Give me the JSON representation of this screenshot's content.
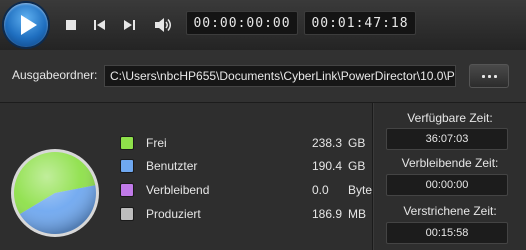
{
  "player": {
    "current_time": "00:00:00:00",
    "total_time": "00:01:47:18",
    "icons": [
      "play-icon",
      "stop-icon",
      "previous-frame-icon",
      "next-frame-icon",
      "volume-icon"
    ]
  },
  "output": {
    "label": "Ausgabeordner:",
    "path": "C:\\Users\\nbcHP655\\Documents\\CyberLink\\PowerDirector\\10.0\\P",
    "browse_icon": "ellipsis-icon"
  },
  "disk": {
    "legend": [
      {
        "label": "Frei",
        "value": "238.3",
        "unit": "GB",
        "color": "#8ee04a"
      },
      {
        "label": "Benutzter",
        "value": "190.4",
        "unit": "GB",
        "color": "#6fa8f0"
      },
      {
        "label": "Verbleibend",
        "value": "0.0",
        "unit": "Byte",
        "color": "#c07ae8"
      },
      {
        "label": "Produziert",
        "value": "186.9",
        "unit": "MB",
        "color": "#bdbdbd"
      }
    ]
  },
  "chart_data": {
    "type": "pie",
    "categories": [
      "Frei",
      "Benutzter",
      "Verbleibend",
      "Produziert"
    ],
    "values": [
      238.3,
      190.4,
      0.0,
      0.1825
    ],
    "units": [
      "GB",
      "GB",
      "Byte",
      "MB"
    ],
    "colors": [
      "#8ee04a",
      "#6fa8f0",
      "#c07ae8",
      "#bdbdbd"
    ]
  },
  "times": {
    "available_label": "Verfügbare Zeit:",
    "available_value": "36:07:03",
    "remaining_label": "Verbleibende Zeit:",
    "remaining_value": "00:00:00",
    "elapsed_label": "Verstrichene Zeit:",
    "elapsed_value": "00:15:58"
  }
}
